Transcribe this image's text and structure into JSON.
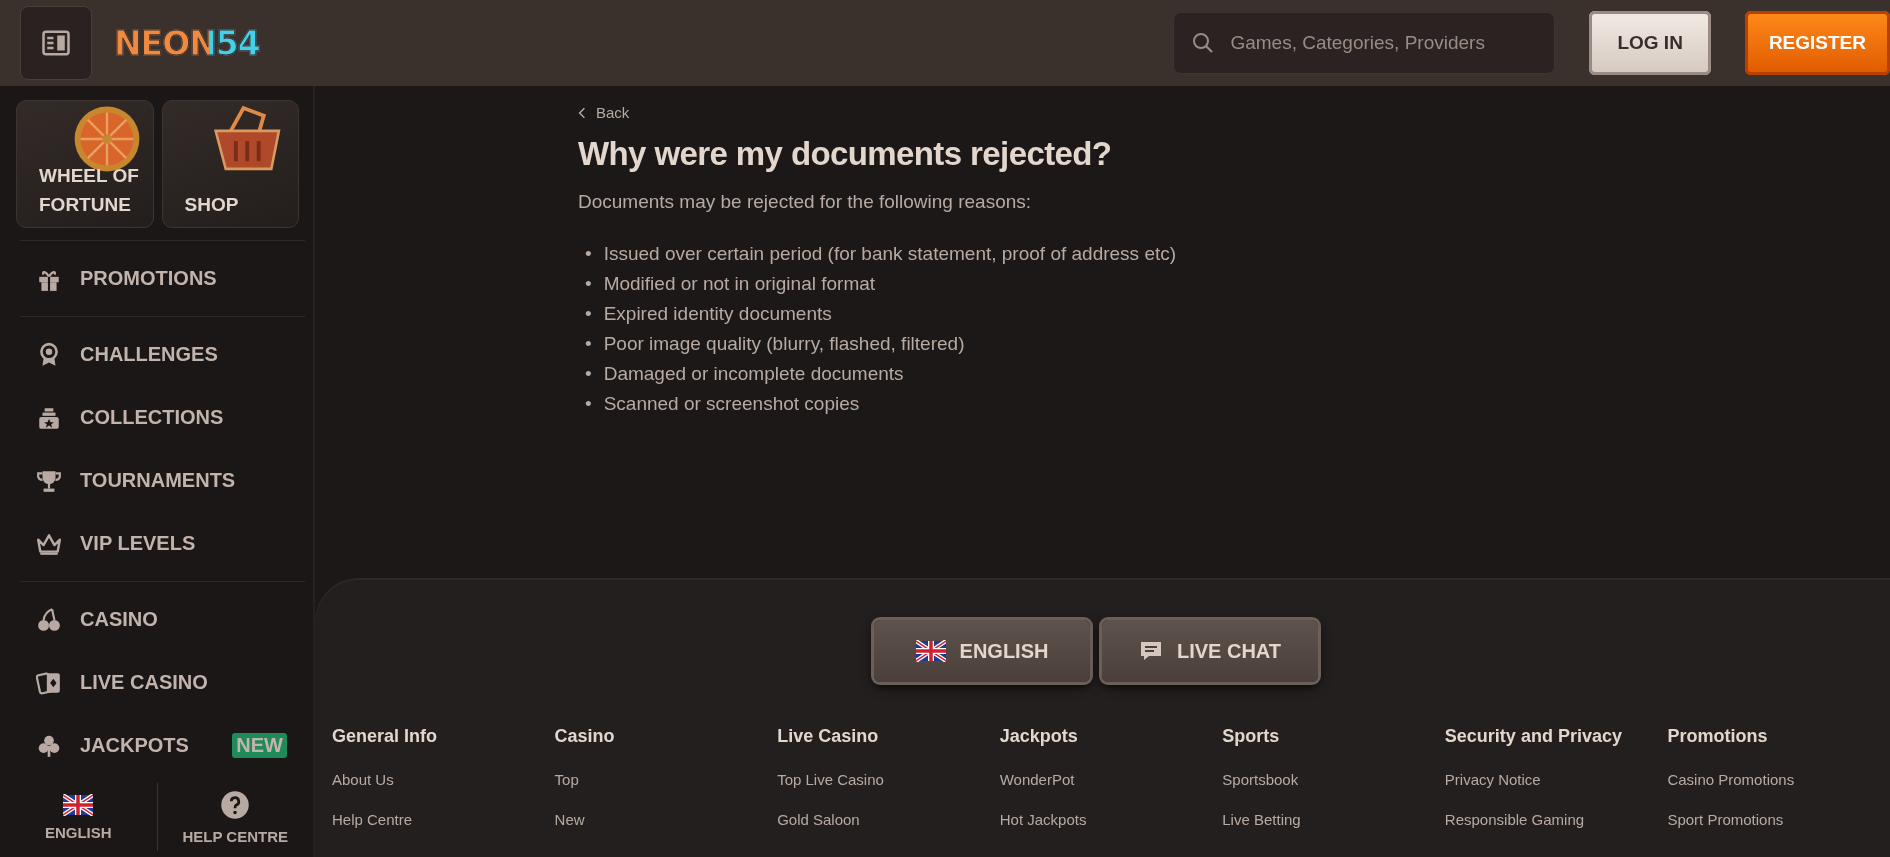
{
  "header": {
    "logo": "NEON54",
    "search": {
      "placeholder": "Games, Categories, Providers"
    },
    "buttons": [
      {
        "label": "LOG IN",
        "kind": "secondary"
      },
      {
        "label": "REGISTER",
        "kind": "primary"
      }
    ]
  },
  "sidebar": {
    "featured": [
      {
        "label": "WHEEL OF FORTUNE",
        "kind": "wheel"
      },
      {
        "label": "SHOP",
        "kind": "basket"
      }
    ],
    "groups": [
      [
        {
          "label": "PROMOTIONS"
        }
      ],
      [
        {
          "label": "CHALLENGES"
        },
        {
          "label": "COLLECTIONS"
        },
        {
          "label": "TOURNAMENTS"
        },
        {
          "label": "VIP LEVELS"
        }
      ],
      [
        {
          "label": "CASINO"
        },
        {
          "label": "LIVE CASINO"
        },
        {
          "label": "JACKPOTS",
          "badge": "NEW"
        }
      ]
    ],
    "bottom": [
      {
        "label": "ENGLISH",
        "kind": "flag"
      },
      {
        "label": "HELP CENTRE",
        "kind": "help"
      }
    ]
  },
  "article": {
    "back": "Back",
    "title": "Why were my documents rejected?",
    "intro": "Documents may be rejected for the following reasons:",
    "marker": "•",
    "reasons": [
      "Issued over certain period (for bank statement, proof of address etc)",
      "Modified or not in original format",
      "Expired identity documents",
      "Poor image quality (blurry, flashed, filtered)",
      "Damaged or incomplete documents",
      "Scanned or screenshot copies"
    ]
  },
  "footer": {
    "buttons": [
      {
        "label": "ENGLISH",
        "kind": "flag"
      },
      {
        "label": "LIVE CHAT",
        "kind": "chat"
      }
    ],
    "columns": [
      {
        "heading": "General Info",
        "links": [
          "About Us",
          "Help Centre"
        ]
      },
      {
        "heading": "Casino",
        "links": [
          "Top",
          "New"
        ]
      },
      {
        "heading": "Live Casino",
        "links": [
          "Top Live Casino",
          "Gold Saloon"
        ]
      },
      {
        "heading": "Jackpots",
        "links": [
          "WonderPot",
          "Hot Jackpots"
        ]
      },
      {
        "heading": "Sports",
        "links": [
          "Sportsbook",
          "Live Betting"
        ]
      },
      {
        "heading": "Security and Privacy",
        "links": [
          "Privacy Notice",
          "Responsible Gaming"
        ]
      },
      {
        "heading": "Promotions",
        "links": [
          "Casino Promotions",
          "Sport Promotions"
        ]
      }
    ]
  }
}
